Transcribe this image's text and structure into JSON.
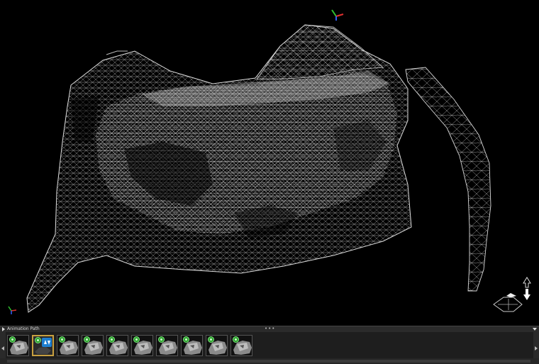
{
  "viewport": {
    "axis_gizmo_top": "axis-triad-icon",
    "axis_gizmo_corner": "axis-triad-icon",
    "nav_icons": [
      "arrow-up-icon",
      "arrow-down-icon",
      "rotate-icon"
    ],
    "colors": {
      "mesh": "#e8e8e8",
      "background": "#000000",
      "axis_x": "#e03030",
      "axis_y": "#30c030",
      "axis_z": "#3060ff"
    }
  },
  "animation_panel": {
    "title": "Animation Path",
    "grip": "•••",
    "collapse_icon": "chevron-down-icon",
    "keyframes": [
      {
        "label": "keyframe-1",
        "active": false
      },
      {
        "label": "keyframe-2",
        "active": true
      },
      {
        "label": "keyframe-3",
        "active": false
      },
      {
        "label": "keyframe-4",
        "active": false
      },
      {
        "label": "keyframe-5",
        "active": false
      },
      {
        "label": "keyframe-6",
        "active": false
      },
      {
        "label": "keyframe-7",
        "active": false
      },
      {
        "label": "keyframe-8",
        "active": false
      },
      {
        "label": "keyframe-9",
        "active": false
      },
      {
        "label": "keyframe-10",
        "active": false
      }
    ],
    "accent_color": "#c8a040",
    "keyframe_icon_color": "#2ca02c"
  }
}
